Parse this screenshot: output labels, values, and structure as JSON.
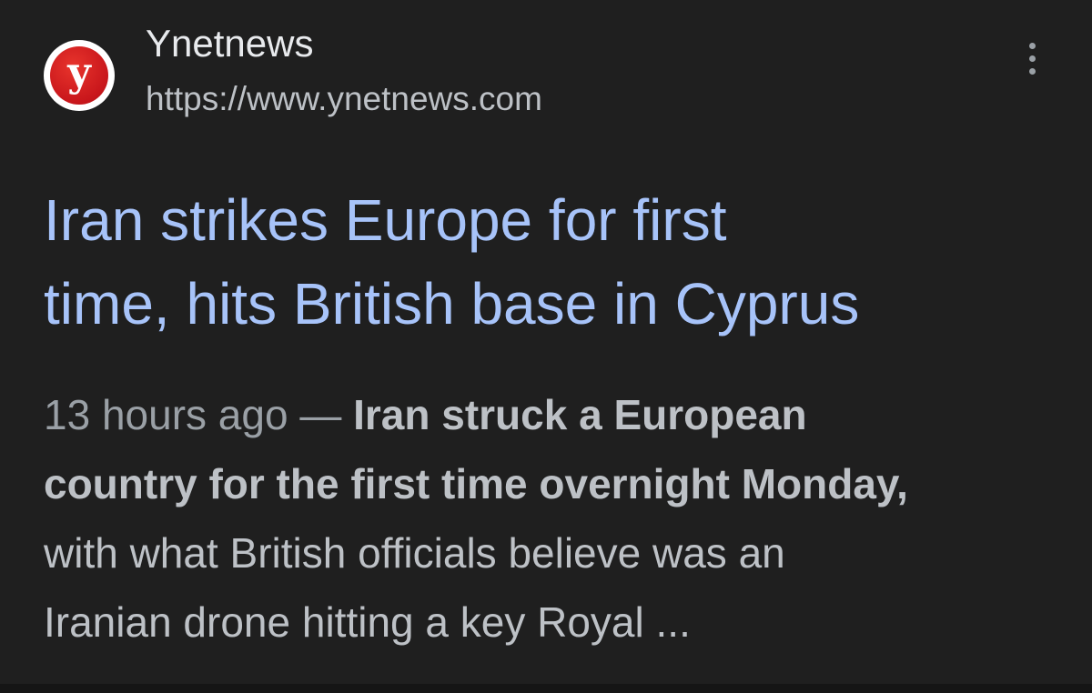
{
  "result": {
    "logo_letter": "y",
    "site_name": "Ynetnews",
    "site_url": "https://www.ynetnews.com",
    "title_lines": [
      "Iran strikes Europe for first",
      "time, hits British base in Cyprus"
    ],
    "snippet": {
      "date": "13 hours ago",
      "separator": " — ",
      "line1_bold": "Iran struck a European",
      "line2_bold": "country for the first time overnight Monday,",
      "line3": "with what British officials believe was an",
      "line4": "Iranian drone hitting a key Royal ..."
    }
  },
  "icons": {
    "more": "more-vert-icon",
    "logo": "ynet-logo-icon"
  },
  "colors": {
    "background": "#1f1f1f",
    "title_link": "#a7c3f9",
    "site_name": "#e8eaed",
    "secondary_text": "#bdc1c6",
    "logo_red": "#c8161b"
  }
}
